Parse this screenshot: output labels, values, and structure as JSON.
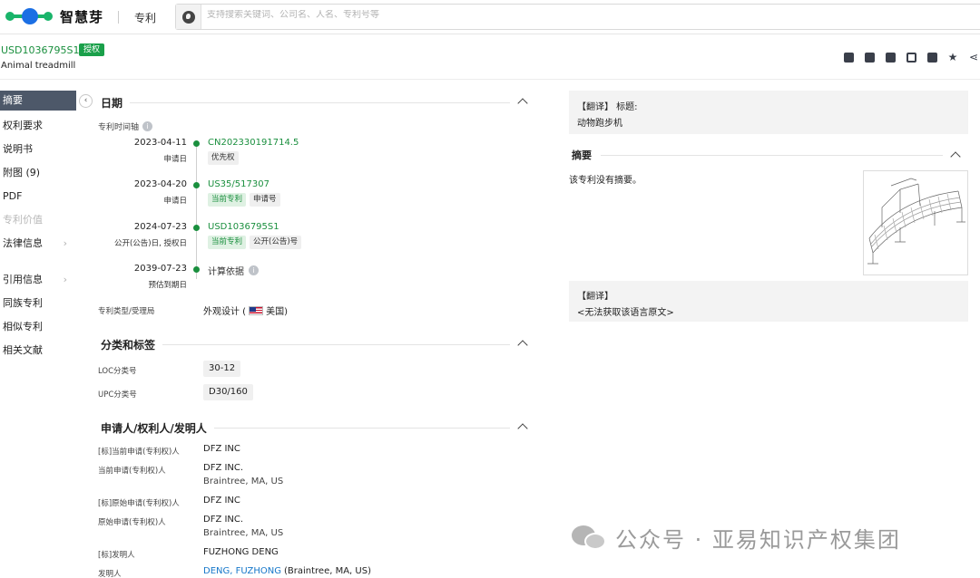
{
  "topbar": {
    "logo_text": "智慧芽",
    "nav_patent": "专利",
    "search_placeholder": "支持搜索关键词、公司名、人名、专利号等"
  },
  "header": {
    "pub_no": "USD1036795S1",
    "status_badge": "授权",
    "title": "Animal treadmill"
  },
  "sidebar": {
    "items": [
      {
        "label": "摘要"
      },
      {
        "label": "权利要求"
      },
      {
        "label": "说明书"
      },
      {
        "label": "附图 (9)"
      },
      {
        "label": "PDF"
      },
      {
        "label": "专利价值"
      },
      {
        "label": "法律信息"
      },
      {
        "label": "引用信息"
      },
      {
        "label": "同族专利"
      },
      {
        "label": "相似专利"
      },
      {
        "label": "相关文献"
      }
    ]
  },
  "dates": {
    "title": "日期",
    "timeline_label": "专利时间轴",
    "rows": [
      {
        "date": "2023-04-11",
        "type": "申请日",
        "number": "CN202330191714.5",
        "tags": [
          "优先权"
        ]
      },
      {
        "date": "2023-04-20",
        "type": "申请日",
        "number": "US35/517307",
        "tags": [
          "当前专利",
          "申请号"
        ]
      },
      {
        "date": "2024-07-23",
        "type": "公开(公告)日, 授权日",
        "number": "USD1036795S1",
        "tags": [
          "当前专利",
          "公开(公告)号"
        ]
      },
      {
        "date": "2039-07-23",
        "type": "预估到期日",
        "number": "计算依据",
        "tags": []
      }
    ],
    "type_office_label": "专利类型/受理局",
    "type_office_value": "外观设计 (",
    "country": "美国)"
  },
  "classification": {
    "title": "分类和标签",
    "loc_label": "LOC分类号",
    "loc_value": "30-12",
    "upc_label": "UPC分类号",
    "upc_value": "D30/160"
  },
  "applicants": {
    "title": "申请人/权利人/发明人",
    "rows": [
      {
        "label": "[标]当前申请(专利权)人",
        "value": "DFZ INC",
        "sub": ""
      },
      {
        "label": "当前申请(专利权)人",
        "value": "DFZ INC.",
        "sub": "Braintree, MA, US"
      },
      {
        "label": "[标]原始申请(专利权)人",
        "value": "DFZ INC",
        "sub": ""
      },
      {
        "label": "原始申请(专利权)人",
        "value": "DFZ INC.",
        "sub": "Braintree, MA, US"
      },
      {
        "label": "[标]发明人",
        "value": "FUZHONG DENG",
        "sub": ""
      },
      {
        "label": "发明人",
        "value": "DENG, FUZHONG",
        "sub": " (Braintree, MA, US)"
      }
    ]
  },
  "right": {
    "translation_label": "【翻译】 标题:",
    "translation_value": "动物跑步机",
    "abstract_title": "摘要",
    "no_abstract": "该专利没有摘要。",
    "translation2_label": "【翻译】",
    "translation2_value": "<无法获取该语言原文>"
  },
  "watermark": {
    "text": "公众号 · 亚易知识产权集团"
  },
  "colors": {
    "brand_green": "#1a8f3e",
    "link_blue": "#1677c9",
    "sidebar_active": "#4d5869",
    "badge_green": "#1aa04a"
  }
}
